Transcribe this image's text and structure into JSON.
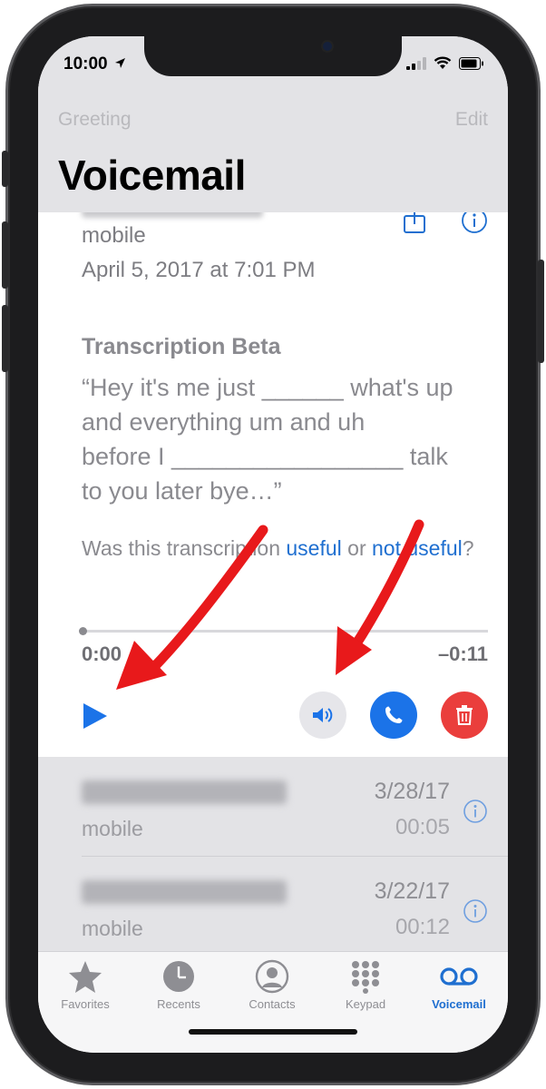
{
  "status_bar": {
    "time": "10:00"
  },
  "nav": {
    "left_label": "Greeting",
    "right_label": "Edit",
    "title": "Voicemail"
  },
  "expanded_voicemail": {
    "type": "mobile",
    "date": "April 5, 2017 at 7:01 PM",
    "transcription_heading": "Transcription Beta",
    "transcription_text": "“Hey it's me just ______ what's up\n  and everything um and uh\n  before I _________________ talk\n  to you later bye…”",
    "feedback_prefix": "Was this transcription ",
    "feedback_useful": "useful",
    "feedback_middle": " or ",
    "feedback_not_useful": "not useful",
    "feedback_suffix": "?",
    "time_elapsed": "0:00",
    "time_remaining": "–0:11",
    "playback_progress": 0
  },
  "voicemail_list": [
    {
      "type": "mobile",
      "date": "3/28/17",
      "duration": "00:05"
    },
    {
      "type": "mobile",
      "date": "3/22/17",
      "duration": "00:12"
    }
  ],
  "tabs": [
    {
      "label": "Favorites",
      "icon": "star-icon"
    },
    {
      "label": "Recents",
      "icon": "clock-icon"
    },
    {
      "label": "Contacts",
      "icon": "person-icon"
    },
    {
      "label": "Keypad",
      "icon": "keypad-icon"
    },
    {
      "label": "Voicemail",
      "icon": "voicemail-icon",
      "active": true
    }
  ],
  "colors": {
    "accent": "#1f6fd0",
    "call": "#1b73e8",
    "delete": "#ea3e3c",
    "annotation_arrow": "#e8191b",
    "header_bg": "#e3e3e6"
  }
}
